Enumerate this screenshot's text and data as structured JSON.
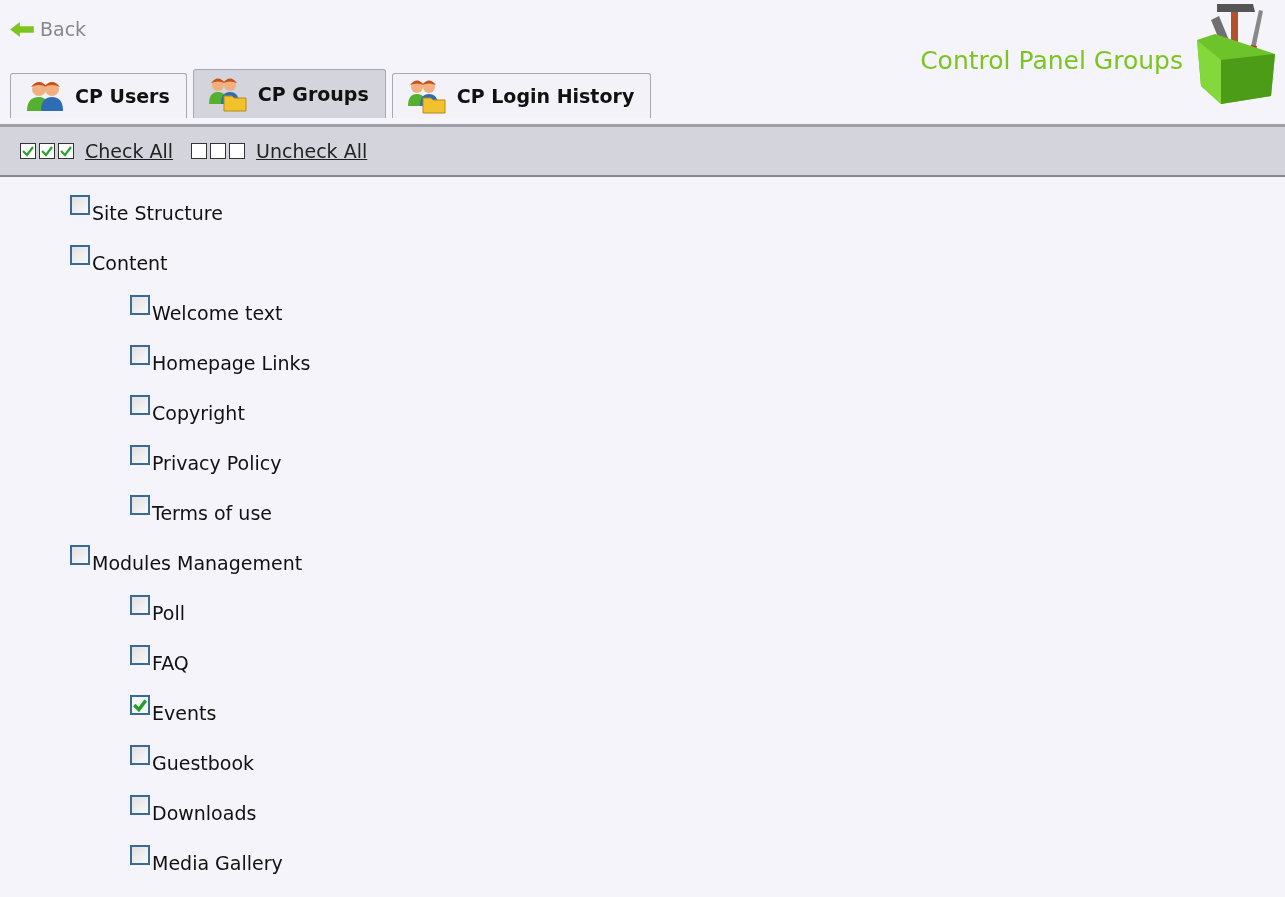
{
  "back": {
    "label": "Back"
  },
  "title": "Control Panel Groups",
  "tabs": [
    {
      "label": "CP Users",
      "kind": "users",
      "selected": false
    },
    {
      "label": "CP Groups",
      "kind": "groups",
      "selected": true
    },
    {
      "label": "CP Login History",
      "kind": "groups",
      "selected": false
    }
  ],
  "toolbar": {
    "check_all": "Check All",
    "uncheck_all": "Uncheck All"
  },
  "tree": [
    {
      "label": "Site Structure",
      "checked": false
    },
    {
      "label": "Content",
      "checked": false,
      "children": [
        {
          "label": "Welcome text",
          "checked": false
        },
        {
          "label": "Homepage Links",
          "checked": false
        },
        {
          "label": "Copyright",
          "checked": false
        },
        {
          "label": "Privacy Policy",
          "checked": false
        },
        {
          "label": "Terms of use",
          "checked": false
        }
      ]
    },
    {
      "label": "Modules Management",
      "checked": false,
      "children": [
        {
          "label": "Poll",
          "checked": false
        },
        {
          "label": "FAQ",
          "checked": false
        },
        {
          "label": "Events",
          "checked": true
        },
        {
          "label": "Guestbook",
          "checked": false
        },
        {
          "label": "Downloads",
          "checked": false
        },
        {
          "label": "Media Gallery",
          "checked": false
        }
      ]
    }
  ]
}
